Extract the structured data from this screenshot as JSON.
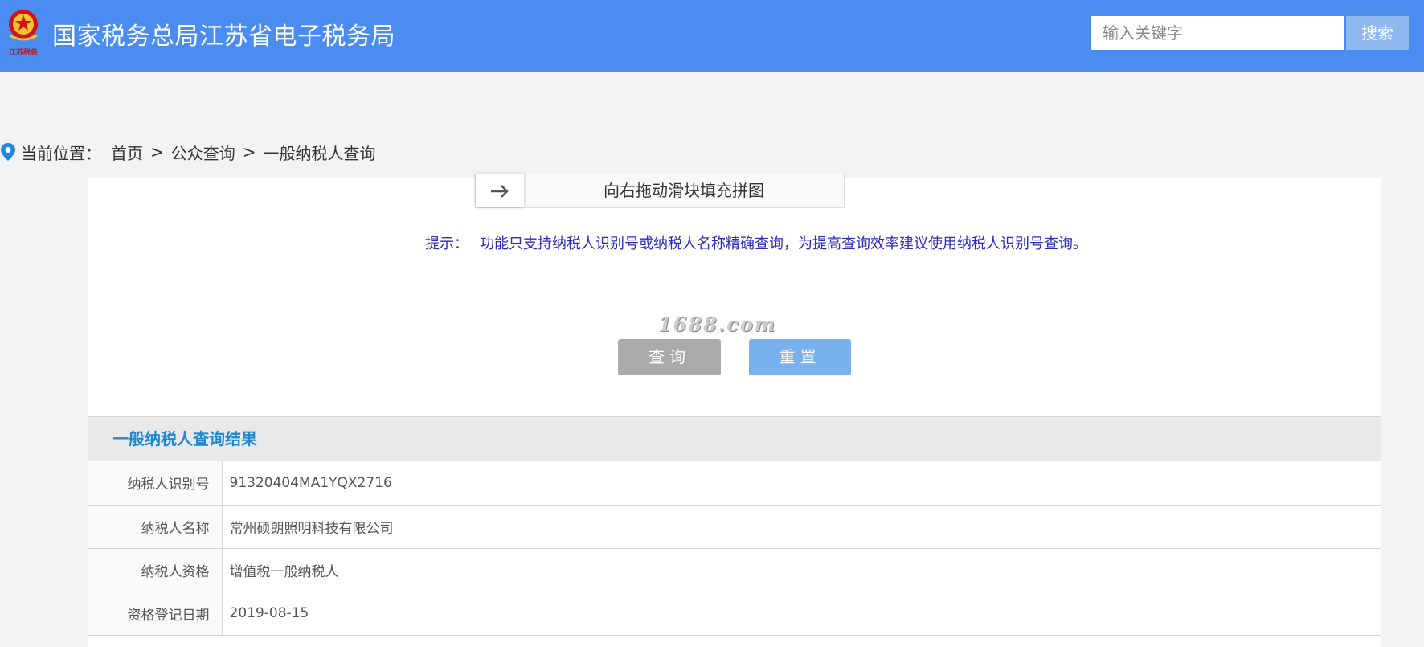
{
  "header": {
    "logo_text": "江苏税务",
    "title": "国家税务总局江苏省电子税务局",
    "search_placeholder": "输入关键字",
    "search_button": "搜索",
    "colors": {
      "header_bg": "#4a8cf0",
      "search_button_bg": "#8fb8f0"
    }
  },
  "breadcrumb": {
    "label": "当前位置：",
    "items": [
      "首页",
      "公众查询",
      "一般纳税人查询"
    ],
    "separator": ">"
  },
  "form": {
    "slider_text": "向右拖动滑块填充拼图",
    "hint_label": "提示：",
    "hint_text": "功能只支持纳税人识别号或纳税人名称精确查询，为提高查询效率建议使用纳税人识别号查询。",
    "watermark": "1688.com",
    "query_button": "查询",
    "reset_button": "重置",
    "colors": {
      "hint": "#2b2bbf",
      "query_bg": "#aaaaaa",
      "reset_bg": "#79b1ee"
    }
  },
  "result": {
    "title": "一般纳税人查询结果",
    "rows": [
      {
        "label": "纳税人识别号",
        "value": "91320404MA1YQX2716"
      },
      {
        "label": "纳税人名称",
        "value": "常州硕朗照明科技有限公司"
      },
      {
        "label": "纳税人资格",
        "value": "增值税一般纳税人"
      },
      {
        "label": "资格登记日期",
        "value": "2019-08-15"
      }
    ],
    "colors": {
      "title": "#1e88d0"
    }
  }
}
